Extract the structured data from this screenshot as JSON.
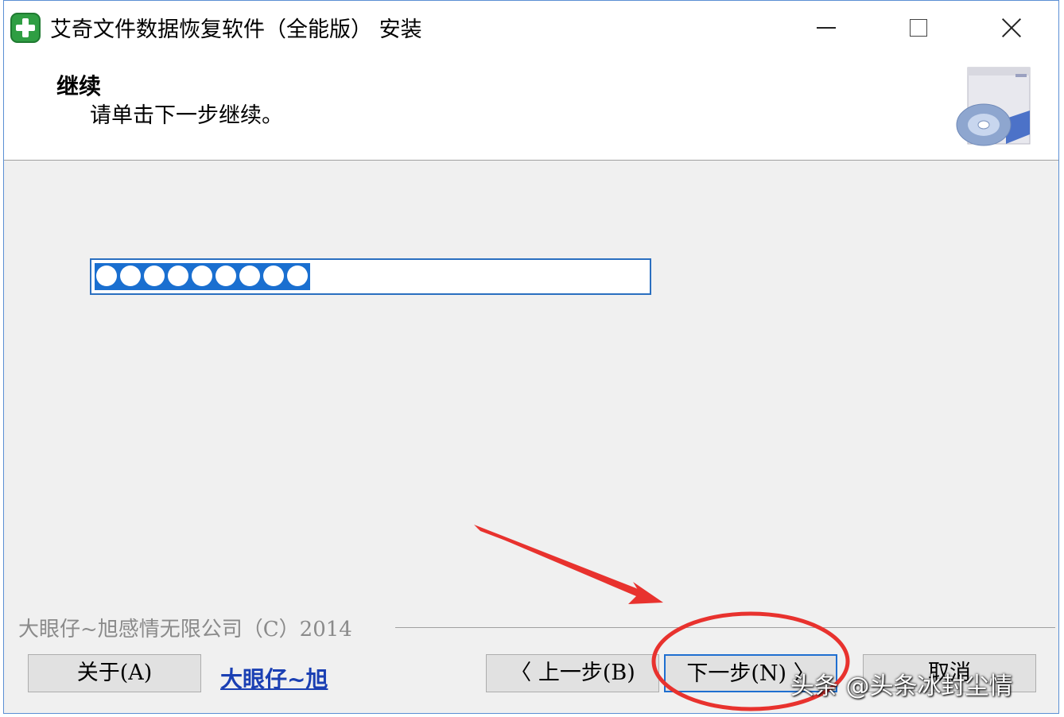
{
  "window": {
    "title": "艾奇文件数据恢复软件（全能版） 安装"
  },
  "header": {
    "title": "继续",
    "subtitle": "请单击下一步继续。",
    "icon": "setup-disc-icon"
  },
  "progress": {
    "fraction": 0.39,
    "segments": 9
  },
  "footer": {
    "brand_text": "大眼仔~旭感情无限公司（C）2014",
    "link_text": "大眼仔~旭"
  },
  "buttons": {
    "about": "关于(A)",
    "back": "〈 上一步(B)",
    "next": "下一步(N) 〉",
    "cancel": "取消"
  },
  "watermark": "头条 @头条冰封尘情",
  "colors": {
    "accent": "#1a6fd0",
    "annotation": "#e8322e",
    "link": "#1a3fb3"
  }
}
